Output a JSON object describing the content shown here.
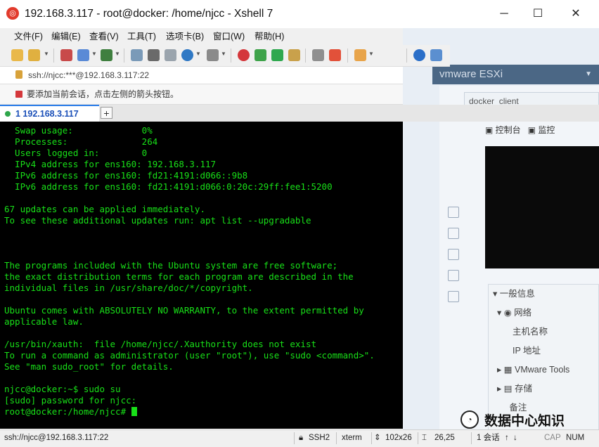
{
  "window": {
    "title": "192.168.3.117 - root@docker: /home/njcc - Xshell 7",
    "controls": {
      "minimize": "─",
      "maximize": "☐",
      "close": "✕"
    }
  },
  "menu": {
    "items": [
      "文件(F)",
      "编辑(E)",
      "查看(V)",
      "工具(T)",
      "选项卡(B)",
      "窗口(W)",
      "帮助(H)"
    ]
  },
  "address": {
    "text": "ssh://njcc:***@192.168.3.117:22"
  },
  "hint": {
    "text": "要添加当前会话，点击左侧的箭头按钮。"
  },
  "tabs": {
    "active_label": "1 192.168.3.117",
    "add_label": "+"
  },
  "terminal": {
    "lines": [
      "  Swap usage:             0%",
      "  Processes:              264",
      "  Users logged in:        0",
      "  IPv4 address for ens160: 192.168.3.117",
      "  IPv6 address for ens160: fd21:4191:d066::9b8",
      "  IPv6 address for ens160: fd21:4191:d066:0:20c:29ff:fee1:5200",
      "",
      "67 updates can be applied immediately.",
      "To see these additional updates run: apt list --upgradable",
      "",
      "",
      "",
      "The programs included with the Ubuntu system are free software;",
      "the exact distribution terms for each program are described in the",
      "individual files in /usr/share/doc/*/copyright.",
      "",
      "Ubuntu comes with ABSOLUTELY NO WARRANTY, to the extent permitted by",
      "applicable law.",
      "",
      "/usr/bin/xauth:  file /home/njcc/.Xauthority does not exist",
      "To run a command as administrator (user \"root\"), use \"sudo <command>\".",
      "See \"man sudo_root\" for details.",
      "",
      "njcc@docker:~$ sudo su",
      "[sudo] password for njcc:"
    ],
    "prompt": "root@docker:/home/njcc# ",
    "fg_color": "#18e018",
    "bg_color": "#000000"
  },
  "status": {
    "connection": "ssh://njcc@192.168.3.117:22",
    "protocol": "SSH2",
    "terminal_type": "xterm",
    "size": "102x26",
    "cursor_pos": "26,25",
    "sessions": "1 会话",
    "cap": "CAP",
    "num": "NUM"
  },
  "background": {
    "vmware_title": "vmware ESXi",
    "client_tab": "docker_client",
    "console_label": "控制台",
    "monitor_label": "监控",
    "info_section": "一般信息",
    "network": "网络",
    "hostname": "主机名称",
    "ip_address": "IP 地址",
    "vmware_tools": "VMware Tools",
    "storage": "存储",
    "notes": "备注"
  },
  "watermark": {
    "text": "数据中心知识"
  }
}
